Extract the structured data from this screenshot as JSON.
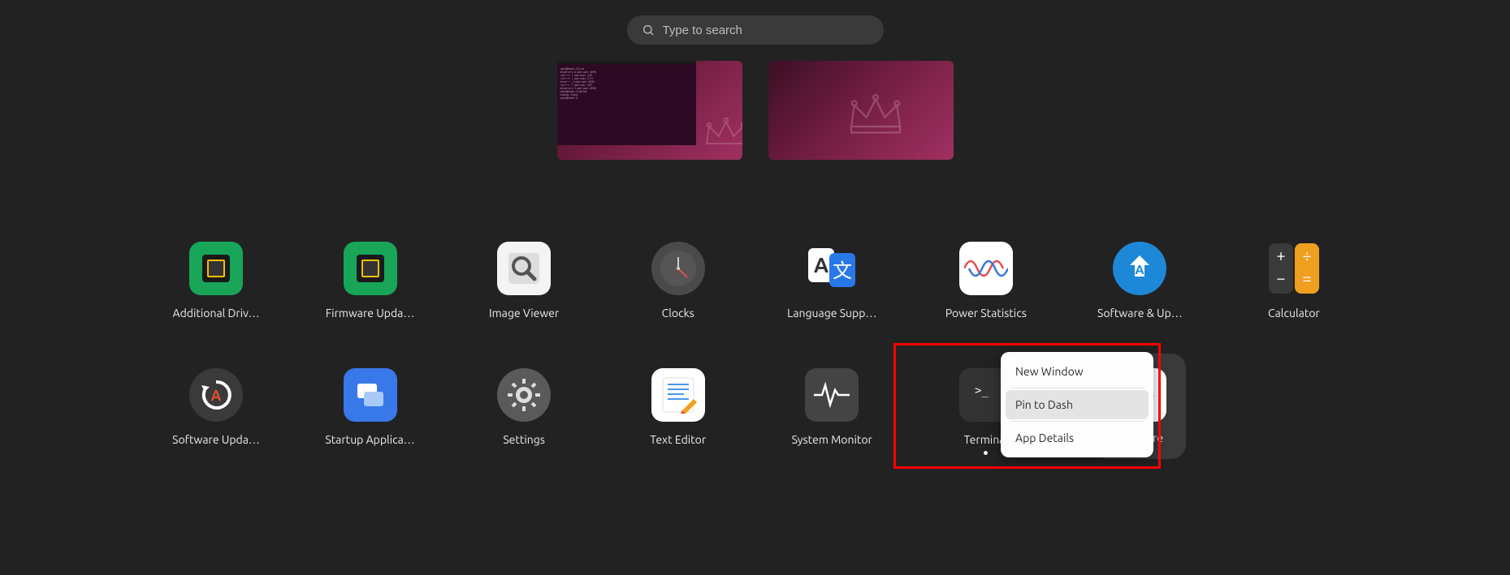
{
  "search": {
    "placeholder": "Type to search"
  },
  "apps_row1": [
    {
      "label": "Additional Driv…"
    },
    {
      "label": "Firmware Upda…"
    },
    {
      "label": "Image Viewer"
    },
    {
      "label": "Clocks"
    },
    {
      "label": "Language Supp…"
    },
    {
      "label": "Power Statistics"
    },
    {
      "label": "Software & Up…"
    },
    {
      "label": "Calculator"
    }
  ],
  "apps_row2": [
    {
      "label": "Software Upda…"
    },
    {
      "label": "Startup Applica…"
    },
    {
      "label": "Settings"
    },
    {
      "label": "Text Editor"
    },
    {
      "label": "System Monitor"
    },
    {
      "label": "Terminal"
    },
    {
      "label": "Software"
    }
  ],
  "context_menu": {
    "new_window": "New Window",
    "pin": "Pin to Dash",
    "details": "App Details"
  }
}
